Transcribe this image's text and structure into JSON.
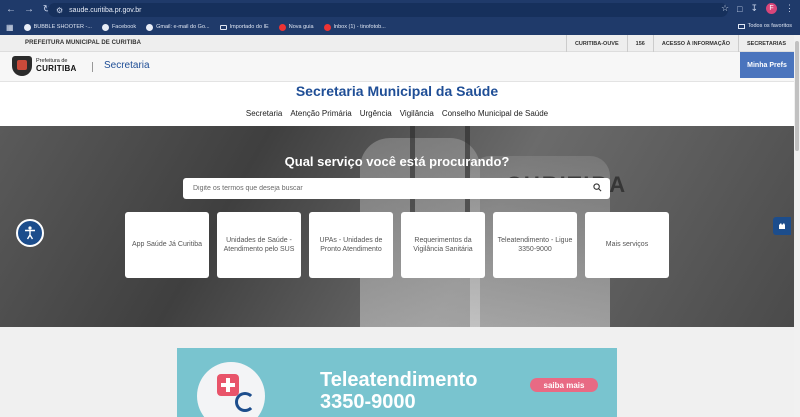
{
  "browser": {
    "url": "saude.curitiba.pr.gov.br",
    "bookmarks": [
      {
        "label": "BUBBLE SHOOTER -...",
        "icon": "globe-icon"
      },
      {
        "label": "Facebook",
        "icon": "globe-icon"
      },
      {
        "label": "Gmail: e-mail do Go...",
        "icon": "globe-icon"
      },
      {
        "label": "Importado do IE",
        "icon": "folder-icon"
      },
      {
        "label": "Nova guia",
        "icon": "youtube-icon"
      },
      {
        "label": "Inbox (1) - tinofotob...",
        "icon": "globe-icon"
      }
    ],
    "all_bookmarks": "Todos os favoritos",
    "profile_initial": "F"
  },
  "gov_bar": {
    "title": "PREFEITURA MUNICIPAL DE CURITIBA",
    "links": [
      "CURITIBA-OUVE",
      "156",
      "ACESSO À INFORMAÇÃO",
      "SECRETARIAS"
    ]
  },
  "header": {
    "logo_line1": "Prefeitura de",
    "logo_line2": "CURITIBA",
    "section": "Secretaria",
    "minha_btn": "Minha Prefs"
  },
  "page_title": "Secretaria Municipal da Saúde",
  "nav": [
    "Secretaria",
    "Atenção Primária",
    "Urgência",
    "Vigilância",
    "Conselho Municipal de Saúde"
  ],
  "hero": {
    "question": "Qual serviço você está procurando?",
    "search_placeholder": "Digite os termos que deseja buscar",
    "watermark": "CURITIBA",
    "cards": [
      "App Saúde Já Curitiba",
      "Unidades de Saúde - Atendimento pelo SUS",
      "UPAs - Unidades de Pronto Atendimento",
      "Requerimentos da Vigilância Sanitária",
      "Teleatendimento - Ligue 3350-9000",
      "Mais serviços"
    ]
  },
  "banner": {
    "title_line1": "Teleatendimento",
    "title_line2": "3350-9000",
    "button": "saiba mais"
  },
  "colors": {
    "brand_blue": "#1f4e96",
    "button_blue": "#4a74bd",
    "banner_teal": "#79c4cf",
    "banner_pink": "#e86a84"
  }
}
